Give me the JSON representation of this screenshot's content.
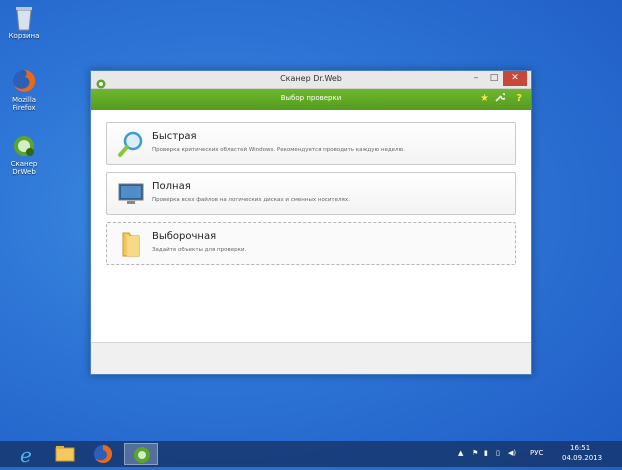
{
  "desktop": {
    "icons": [
      {
        "label_line1": "Корзина",
        "label_line2": "",
        "icon": "recycle-bin-icon"
      },
      {
        "label_line1": "Mozilla",
        "label_line2": "Firefox",
        "icon": "firefox-icon"
      },
      {
        "label_line1": "Сканер",
        "label_line2": "DrWeb",
        "icon": "drweb-scanner-icon"
      }
    ]
  },
  "window": {
    "title": "Сканер Dr.Web",
    "controls": {
      "minimize": "–",
      "maximize": "□",
      "close": "✕"
    },
    "header": {
      "title": "Выбор проверки",
      "star": "★",
      "settings": "🔧",
      "help": "?"
    },
    "options": [
      {
        "title": "Быстрая",
        "description": "Проверка критических областей Windows. Рекомендуется проводить каждую неделю.",
        "icon": "magnifier-icon"
      },
      {
        "title": "Полная",
        "description": "Проверка всех файлов на логических дисках и сменных носителях.",
        "icon": "monitor-icon"
      },
      {
        "title": "Выборочная",
        "description": "Задайте объекты для проверки.",
        "icon": "folder-icon"
      }
    ]
  },
  "taskbar": {
    "apps": [
      "internet-explorer-icon",
      "file-explorer-icon",
      "firefox-icon",
      "drweb-icon"
    ],
    "tray": {
      "lang": "РУС",
      "time": "16:51",
      "date": "04.09.2013"
    }
  },
  "colors": {
    "accent_green": "#6cb82e",
    "desktop_blue": "#2d74d6",
    "close_red": "#c7473a"
  }
}
